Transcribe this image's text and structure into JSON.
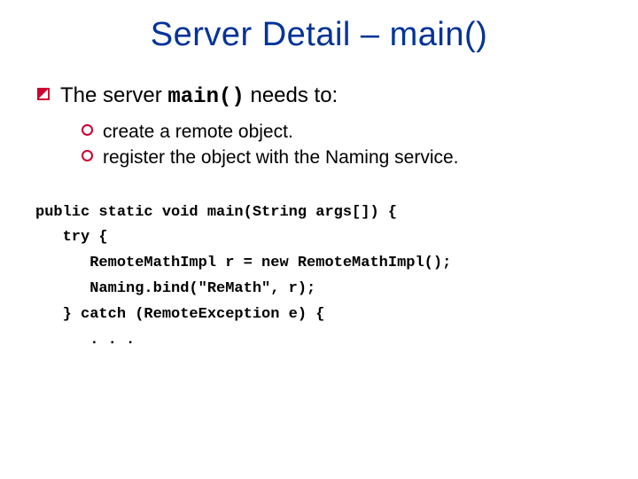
{
  "title": "Server Detail – main()",
  "point1_a": "The server ",
  "point1_code": "main()",
  "point1_b": " needs to:",
  "sub1": "create a remote object.",
  "sub2": "register the object with the Naming service.",
  "code": "public static void main(String args[]) {\n   try {\n      RemoteMathImpl r = new RemoteMathImpl();\n      Naming.bind(\"ReMath\", r);\n   } catch (RemoteException e) {\n      . . ."
}
